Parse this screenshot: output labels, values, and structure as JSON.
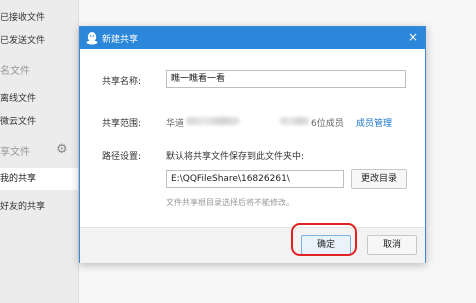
{
  "sidebar": {
    "items": [
      {
        "label": "已接收文件"
      },
      {
        "label": "已发送文件"
      },
      {
        "label": "名文件"
      },
      {
        "label": "离线文件"
      },
      {
        "label": "微云文件"
      },
      {
        "label": "享文件"
      },
      {
        "label": "我的共享"
      },
      {
        "label": "好友的共享"
      }
    ],
    "active_index": 6
  },
  "dialog": {
    "title": "新建共享",
    "close_glyph": "×",
    "share_name_label": "共享名称:",
    "share_name_value": "瞧一瞧看一看",
    "scope_label": "共享范围:",
    "scope_prefix": "华道",
    "scope_members": "6位成员",
    "member_manage_link": "成员管理",
    "path_label": "路径设置:",
    "path_desc": "默认将共享文件保存到此文件夹中:",
    "path_value": "E:\\QQFileShare\\16826261\\",
    "change_dir_button": "更改目录",
    "hint": "文件共享根目录选择后将不能修改。",
    "ok_button": "确定",
    "cancel_button": "取消"
  },
  "colors": {
    "title_bar": "#2b87d9",
    "link": "#1a74c8",
    "highlight_circle": "#e22222"
  },
  "icons": {
    "title_icon": "qq-penguin-icon",
    "sidebar_settings": "gear-icon",
    "close": "close-icon"
  }
}
